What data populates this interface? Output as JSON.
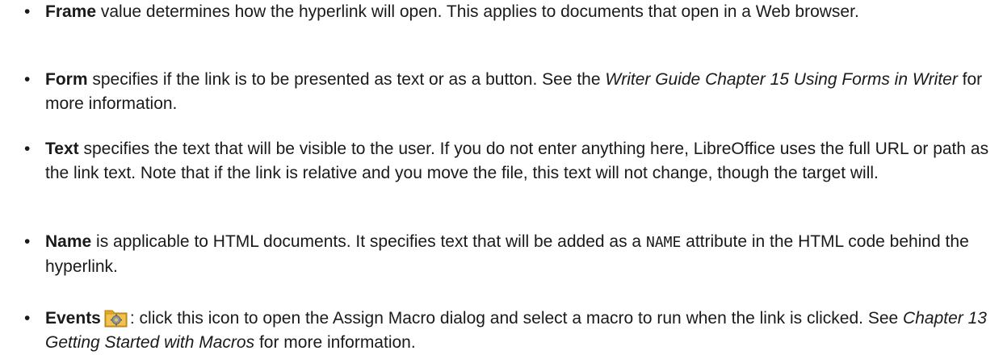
{
  "bullet_char": "•",
  "items": [
    {
      "term": "Frame",
      "desc": " value determines how the hyperlink will open. This applies to documents that open in a Web browser."
    },
    {
      "term": "Form",
      "desc_before_ref": " specifies if the link is to be presented as text or as a button. See the ",
      "ref": "Writer Guide Chapter 15 Using Forms in Writer",
      "desc_after_ref": " for more information."
    },
    {
      "term": "Text",
      "desc": " specifies the text that will be visible to the user. If you do not enter anything here, LibreOffice uses the full URL or path as the link text. Note that if the link is relative and you move the file, this text will not change, though the target will."
    },
    {
      "term": "Name",
      "desc_before_code": " is applicable to HTML documents. It specifies text that will be added as a ",
      "code": "NAME",
      "desc_after_code": " attribute in the HTML code behind the hyperlink."
    },
    {
      "term": "Events",
      "icon": "events-macro-icon",
      "desc_before_ref": ": click this icon to open the Assign Macro dialog and select a macro to run when the link is clicked. See ",
      "ref": "Chapter 13 Getting Started with Macros",
      "desc_after_ref": " for more information."
    }
  ],
  "colors": {
    "text": "#1a1a1a",
    "icon_folder": "#f2c14e",
    "icon_gear": "#7a8a99"
  }
}
